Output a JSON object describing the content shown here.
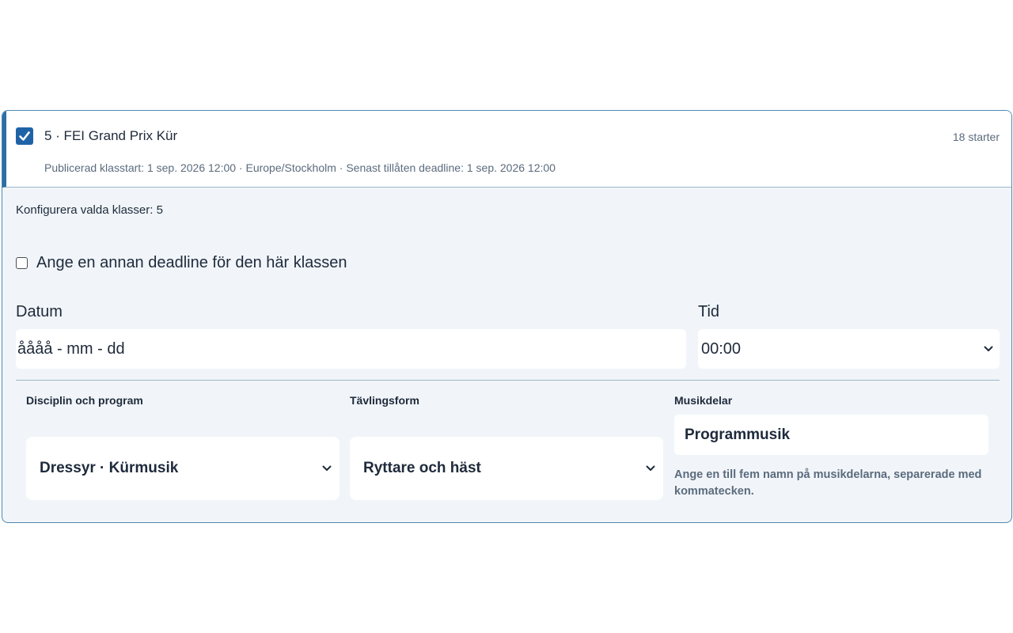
{
  "class_card": {
    "selected": true,
    "title": "5 · FEI Grand Prix Kür",
    "starts": "18 starter",
    "meta": "Publicerad klasstart: 1 sep. 2026 12:00 · Europe/Stockholm · Senast tillåten deadline: 1 sep. 2026 12:00"
  },
  "config": {
    "label": "Konfigurera valda klasser: 5",
    "custom_deadline": {
      "checked": false,
      "label": "Ange en annan deadline för den här klassen"
    },
    "date": {
      "label": "Datum",
      "placeholder": "åååå - mm - dd"
    },
    "time": {
      "label": "Tid",
      "value": "00:00"
    },
    "discipline": {
      "label": "Disciplin och program",
      "value": "Dressyr · Kürmusik"
    },
    "competition_form": {
      "label": "Tävlingsform",
      "value": "Ryttare och häst"
    },
    "music_parts": {
      "label": "Musikdelar",
      "value": "Programmusik",
      "help": "Ange en till fem namn på musikdelarna, separerade med kommatecken."
    }
  },
  "colors": {
    "accent": "#1f63a6",
    "card_border": "#4f87b3",
    "panel_bg": "#f1f5f9",
    "muted_text": "#5b6b7d"
  },
  "icons": {
    "class_checkbox": "checkmark-icon",
    "select_arrow": "chevron-down-icon"
  }
}
